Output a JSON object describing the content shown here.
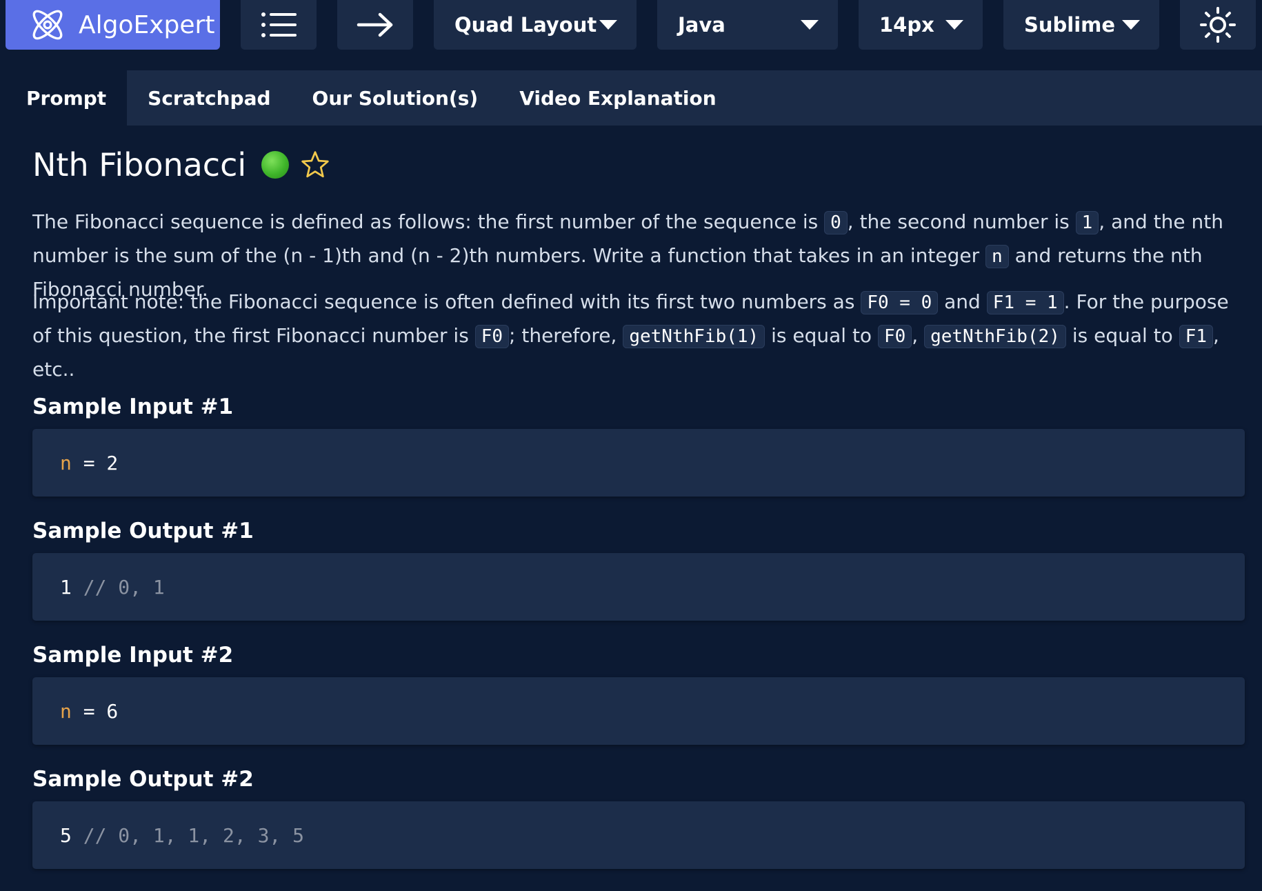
{
  "toolbar": {
    "brand": "AlgoExpert",
    "layout": "Quad Layout",
    "language": "Java",
    "font_size": "14px",
    "theme": "Sublime",
    "brand_color": "#5a6fe6"
  },
  "tabs": [
    {
      "label": "Prompt",
      "active": true
    },
    {
      "label": "Scratchpad",
      "active": false
    },
    {
      "label": "Our Solution(s)",
      "active": false
    },
    {
      "label": "Video Explanation",
      "active": false
    }
  ],
  "problem": {
    "title": "Nth Fibonacci",
    "difficulty_color": "#3fb52a",
    "para1": {
      "t1": "The Fibonacci sequence is defined as follows: the first number of the sequence is ",
      "c1": "0",
      "t2": ", the second number is ",
      "c2": "1",
      "t3": ", and the nth number is the sum of the (n - 1)th and (n - 2)th numbers. Write a function that takes in an integer ",
      "c3": "n",
      "t4": " and returns the nth Fibonacci number."
    },
    "para2": {
      "t1": "Important note: the Fibonacci sequence is often defined with its first two numbers as ",
      "c1": "F0 = 0",
      "t2": " and ",
      "c2": "F1 = 1",
      "t3": ". For the purpose of this question, the first Fibonacci number is ",
      "c3": "F0",
      "t4": "; therefore, ",
      "c4": "getNthFib(1)",
      "t5": " is equal to ",
      "c5": "F0",
      "t6": ", ",
      "c6": "getNthFib(2)",
      "t7": " is equal to ",
      "c7": "F1",
      "t8": ", etc.."
    },
    "samples": [
      {
        "heading": "Sample Input #1",
        "var": "n",
        "rest": " = 2",
        "comment": ""
      },
      {
        "heading": "Sample Output #1",
        "var": "",
        "rest": "1",
        "comment": " // 0, 1"
      },
      {
        "heading": "Sample Input #2",
        "var": "n",
        "rest": " = 6",
        "comment": ""
      },
      {
        "heading": "Sample Output #2",
        "var": "",
        "rest": "5",
        "comment": " // 0, 1, 1, 2, 3, 5"
      }
    ]
  }
}
